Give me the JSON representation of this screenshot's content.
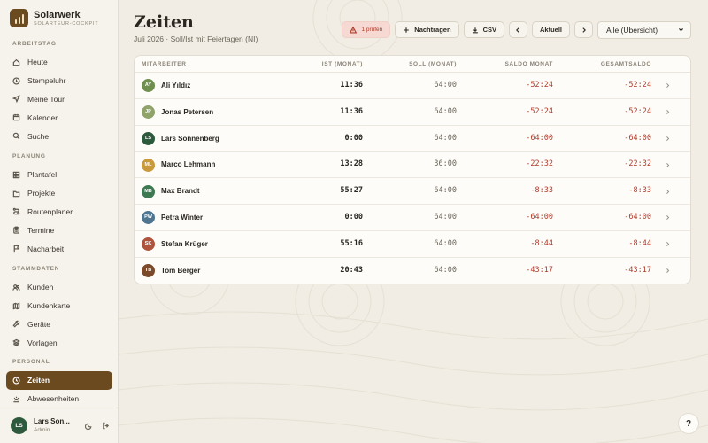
{
  "brand": {
    "name": "Solarwerk",
    "subtitle": "SOLARTEUR-COCKPIT"
  },
  "sidebar": {
    "sections": [
      {
        "heading": "ARBEITSTAG",
        "items": [
          {
            "label": "Heute",
            "icon": "home-icon"
          },
          {
            "label": "Stempeluhr",
            "icon": "clock-icon"
          },
          {
            "label": "Meine Tour",
            "icon": "navigation-icon"
          },
          {
            "label": "Kalender",
            "icon": "calendar-icon"
          },
          {
            "label": "Suche",
            "icon": "search-icon"
          }
        ]
      },
      {
        "heading": "PLANUNG",
        "items": [
          {
            "label": "Plantafel",
            "icon": "grid-icon"
          },
          {
            "label": "Projekte",
            "icon": "folder-icon"
          },
          {
            "label": "Routenplaner",
            "icon": "route-icon"
          },
          {
            "label": "Termine",
            "icon": "clipboard-icon"
          },
          {
            "label": "Nacharbeit",
            "icon": "flag-icon"
          }
        ]
      },
      {
        "heading": "STAMMDATEN",
        "items": [
          {
            "label": "Kunden",
            "icon": "users-icon"
          },
          {
            "label": "Kundenkarte",
            "icon": "map-icon"
          },
          {
            "label": "Geräte",
            "icon": "tool-icon"
          },
          {
            "label": "Vorlagen",
            "icon": "layers-icon"
          }
        ]
      },
      {
        "heading": "PERSONAL",
        "items": [
          {
            "label": "Zeiten",
            "icon": "clock-icon",
            "active": true
          },
          {
            "label": "Abwesenheiten",
            "icon": "sun-icon"
          }
        ]
      }
    ]
  },
  "user": {
    "initials": "LS",
    "name": "Lars Son...",
    "role": "Admin"
  },
  "page": {
    "title": "Zeiten",
    "subtitle": "Juli 2026 · Soll/Ist mit Feiertagen (NI)"
  },
  "toolbar": {
    "warning_label": "1 prüfen",
    "add_label": "Nachtragen",
    "csv_label": "CSV",
    "current_label": "Aktuell",
    "filter_value": "Alle (Übersicht)"
  },
  "table": {
    "headers": {
      "employee": "MITARBEITER",
      "ist": "IST (MONAT)",
      "soll": "SOLL (MONAT)",
      "saldo": "SALDO MONAT",
      "gesamt": "GESAMTSALDO"
    },
    "rows": [
      {
        "initials": "AY",
        "color": "#6f8f4e",
        "name": "Ali Yıldız",
        "ist": "11:36",
        "soll": "64:00",
        "saldo": "-52:24",
        "gesamt": "-52:24"
      },
      {
        "initials": "JP",
        "color": "#8fa36a",
        "name": "Jonas Petersen",
        "ist": "11:36",
        "soll": "64:00",
        "saldo": "-52:24",
        "gesamt": "-52:24"
      },
      {
        "initials": "LS",
        "color": "#2d5a3d",
        "name": "Lars Sonnenberg",
        "ist": "0:00",
        "soll": "64:00",
        "saldo": "-64:00",
        "gesamt": "-64:00"
      },
      {
        "initials": "ML",
        "color": "#c99a3c",
        "name": "Marco Lehmann",
        "ist": "13:28",
        "soll": "36:00",
        "saldo": "-22:32",
        "gesamt": "-22:32"
      },
      {
        "initials": "MB",
        "color": "#3d7a52",
        "name": "Max Brandt",
        "ist": "55:27",
        "soll": "64:00",
        "saldo": "-8:33",
        "gesamt": "-8:33"
      },
      {
        "initials": "PW",
        "color": "#4f7590",
        "name": "Petra Winter",
        "ist": "0:00",
        "soll": "64:00",
        "saldo": "-64:00",
        "gesamt": "-64:00"
      },
      {
        "initials": "SK",
        "color": "#b0533c",
        "name": "Stefan Krüger",
        "ist": "55:16",
        "soll": "64:00",
        "saldo": "-8:44",
        "gesamt": "-8:44"
      },
      {
        "initials": "TB",
        "color": "#7a4a2a",
        "name": "Tom Berger",
        "ist": "20:43",
        "soll": "64:00",
        "saldo": "-43:17",
        "gesamt": "-43:17"
      }
    ]
  },
  "help": {
    "label": "?"
  }
}
